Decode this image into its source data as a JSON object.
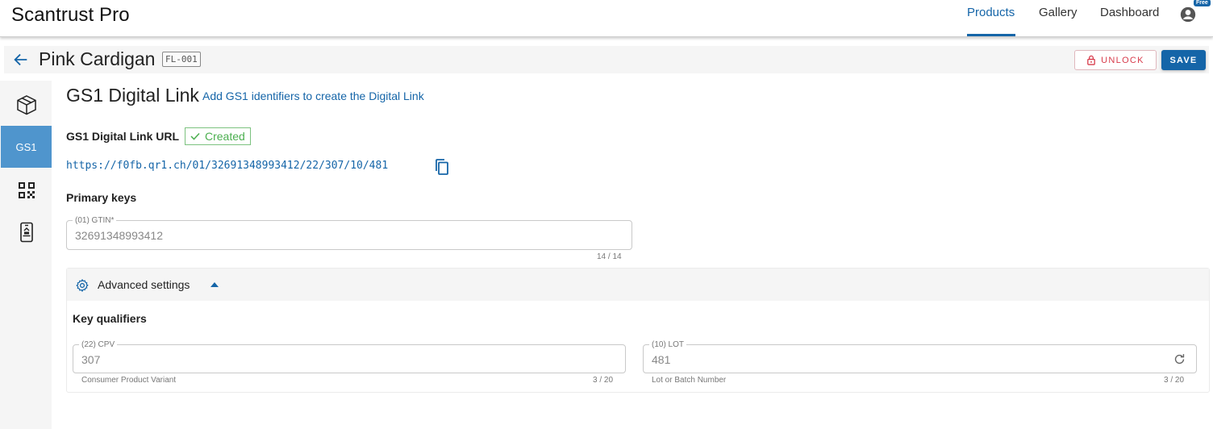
{
  "app": {
    "brand": "Scantrust Pro",
    "plan_badge": "Free"
  },
  "nav": {
    "items": [
      "Products",
      "Gallery",
      "Dashboard"
    ],
    "active": "Products"
  },
  "header": {
    "product_name": "Pink Cardigan",
    "sku": "FL-001",
    "unlock_label": "UNLOCK",
    "save_label": "SAVE"
  },
  "sidebar": {
    "items": [
      {
        "icon": "box-icon",
        "label": ""
      },
      {
        "icon": "",
        "label": "GS1"
      },
      {
        "icon": "qr-code-icon",
        "label": ""
      },
      {
        "icon": "phone-scan-icon",
        "label": ""
      }
    ],
    "active_index": 1
  },
  "section": {
    "title": "GS1 Digital Link",
    "link_text": "Add GS1 identifiers to create the Digital Link",
    "url_label": "GS1 Digital Link URL",
    "status_badge": "Created",
    "url": "https://f0fb.qr1.ch/01/32691348993412/22/307/10/481",
    "primary_keys_label": "Primary keys"
  },
  "gtin_field": {
    "label": "(01) GTIN*",
    "value": "32691348993412",
    "counter": "14 / 14"
  },
  "advanced": {
    "label": "Advanced settings",
    "expanded": true,
    "key_qualifiers_label": "Key qualifiers",
    "cpv": {
      "label": "(22) CPV",
      "value": "307",
      "helper": "Consumer Product Variant",
      "counter": "3 / 20"
    },
    "lot": {
      "label": "(10) LOT",
      "value": "481",
      "helper": "Lot or Batch Number",
      "counter": "3 / 20"
    }
  },
  "colors": {
    "primary": "#1565a8",
    "sidebar_active": "#4f95cd",
    "unlock_red": "#d83b4b",
    "success_green": "#4caf50"
  }
}
